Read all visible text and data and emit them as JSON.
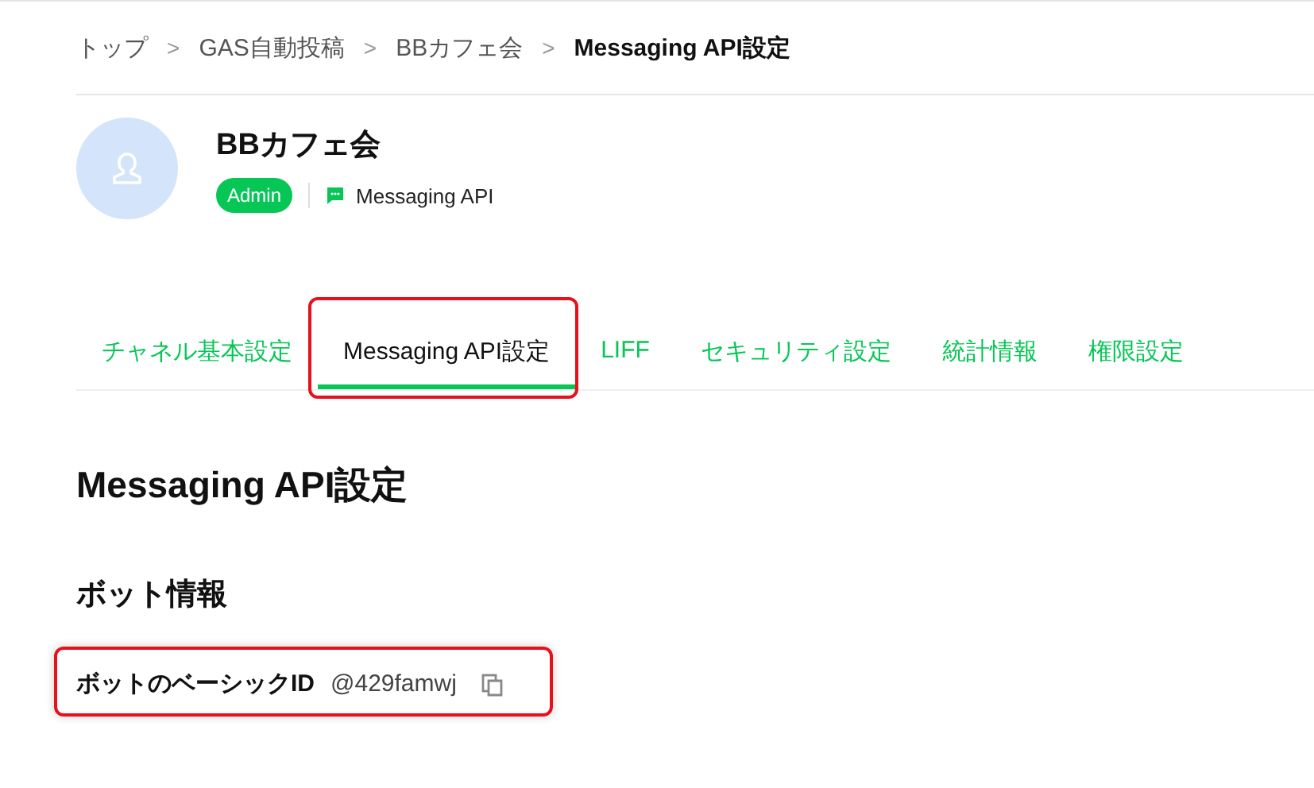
{
  "breadcrumb": [
    {
      "label": "トップ",
      "current": false
    },
    {
      "label": "GAS自動投稿",
      "current": false
    },
    {
      "label": "BBカフェ会",
      "current": false
    },
    {
      "label": "Messaging API設定",
      "current": true
    }
  ],
  "breadcrumb_separator": ">",
  "channel": {
    "name": "BBカフェ会",
    "role_badge": "Admin",
    "type": "Messaging API"
  },
  "tabs": [
    {
      "label": "チャネル基本設定",
      "selected": false,
      "highlighted": false
    },
    {
      "label": "Messaging API設定",
      "selected": true,
      "highlighted": true
    },
    {
      "label": "LIFF",
      "selected": false,
      "highlighted": false
    },
    {
      "label": "セキュリティ設定",
      "selected": false,
      "highlighted": false
    },
    {
      "label": "統計情報",
      "selected": false,
      "highlighted": false
    },
    {
      "label": "権限設定",
      "selected": false,
      "highlighted": false
    }
  ],
  "page_title": "Messaging API設定",
  "section_title": "ボット情報",
  "fields": [
    {
      "label": "ボットのベーシックID",
      "value": "@429famwj",
      "highlighted": true
    }
  ]
}
